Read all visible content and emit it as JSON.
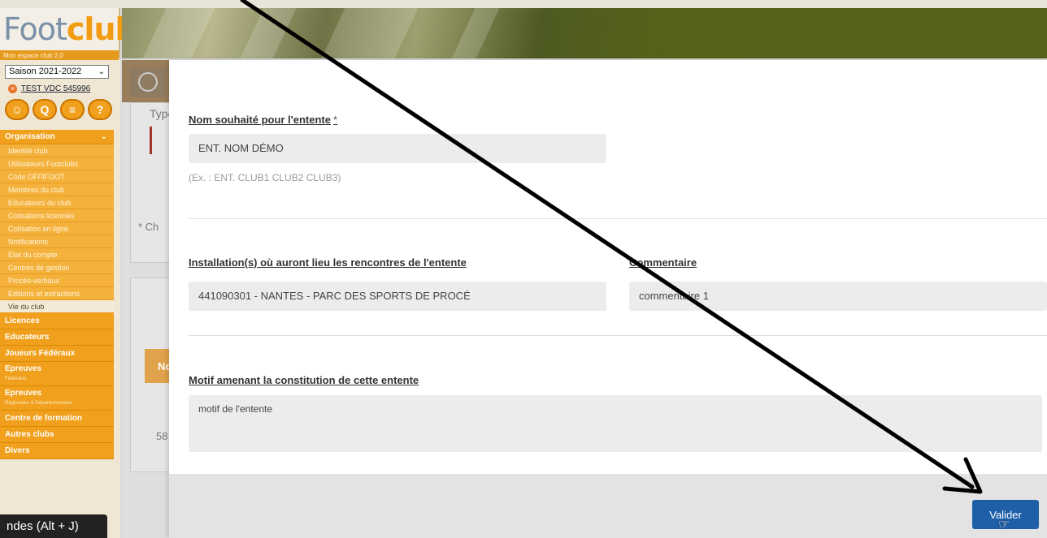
{
  "brand": {
    "logo_prefix": "Foot",
    "logo_suffix": "clubs",
    "logo_sub": "Mon espace club 2.0"
  },
  "sidebar": {
    "season": "Saison 2021-2022",
    "club_name": "TEST VDC 545996",
    "tool_icons": [
      "user-search-icon",
      "search-icon",
      "document-icon",
      "help-icon"
    ],
    "tool_glyphs": [
      "☺",
      "Q",
      "≡",
      "?"
    ],
    "section_org": "Organisation",
    "org_items": [
      "Identité club",
      "Utilisateurs Footclubs",
      "Code OFFIFOOT",
      "Membres du club",
      "Educateurs du club",
      "Cotisations licenciés",
      "Cotisation en ligne",
      "Notifications",
      "Etat du compte",
      "Centres de gestion",
      "Procès-verbaux",
      "Editions et extractions",
      "Vie du club"
    ],
    "sections": {
      "licences": "Licences",
      "educateurs": "Educateurs",
      "joueurs": "Joueurs Fédéraux",
      "epreuves_fed": "Epreuves",
      "epreuves_fed_sub": "Fédérales",
      "epreuves_reg": "Epreuves",
      "epreuves_reg_sub": "Régionales & Départementales",
      "formation": "Centre de formation",
      "autres": "Autres clubs",
      "divers": "Divers"
    },
    "tooltip": "ndes (Alt + J)"
  },
  "background": {
    "type_label": "Type",
    "ch_label": "* Ch",
    "no_label": "No",
    "num_label": "58"
  },
  "modal": {
    "name_label": "Nom souhaité pour l'entente",
    "required_mark": "*",
    "name_value": "ENT. NOM DÉMO",
    "name_hint": "(Ex. : ENT. CLUB1 CLUB2 CLUB3)",
    "installation_label": "Installation(s) où auront lieu les rencontres de l'entente",
    "installation_value": "441090301 - NANTES - PARC DES SPORTS DE PROCÉ",
    "comment_label": "Commentaire",
    "comment_value": "commentaire 1",
    "motif_label": "Motif amenant la constitution de cette entente",
    "motif_value": "motif de l'entente",
    "validate_label": "Valider"
  },
  "colors": {
    "accent_orange": "#f0a01c",
    "button_blue": "#1f5fa8",
    "arrow": "#000000"
  }
}
